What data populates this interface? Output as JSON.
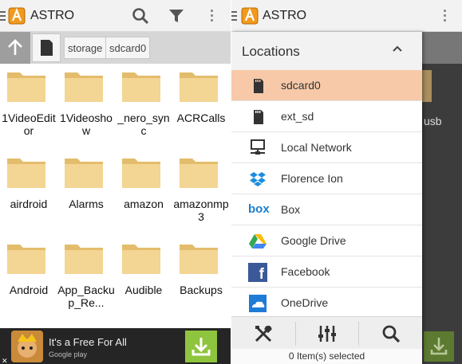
{
  "left_screen": {
    "app_title": "ASTRO",
    "logo_letter": "A",
    "toolbar_icons": [
      "menu-icon",
      "search-icon",
      "filter-icon",
      "overflow-menu-icon"
    ],
    "breadcrumb": [
      "storage",
      "sdcard0"
    ],
    "folders": [
      {
        "name": "1VideoEditor"
      },
      {
        "name": "1Videoshow"
      },
      {
        "name": "_nero_sync"
      },
      {
        "name": "ACRCalls"
      },
      {
        "name": "airdroid"
      },
      {
        "name": "Alarms"
      },
      {
        "name": "amazon"
      },
      {
        "name": "amazonmp3"
      },
      {
        "name": "Android"
      },
      {
        "name": "App_Backup_Re..."
      },
      {
        "name": "Audible"
      },
      {
        "name": "Backups"
      }
    ],
    "ad": {
      "text": "It's a Free For All",
      "store": "Google play",
      "close": "✕"
    }
  },
  "right_screen": {
    "app_title": "ASTRO",
    "logo_letter": "A",
    "drawer": {
      "title": "Locations",
      "items": [
        {
          "label": "sdcard0",
          "icon": "sdcard-icon",
          "selected": true
        },
        {
          "label": "ext_sd",
          "icon": "sdcard-icon",
          "selected": false
        },
        {
          "label": "Local Network",
          "icon": "network-icon",
          "selected": false
        },
        {
          "label": "Florence Ion",
          "icon": "dropbox-icon",
          "selected": false
        },
        {
          "label": "Box",
          "icon": "box-icon",
          "selected": false
        },
        {
          "label": "Google Drive",
          "icon": "google-drive-icon",
          "selected": false
        },
        {
          "label": "Facebook",
          "icon": "facebook-icon",
          "selected": false
        },
        {
          "label": "OneDrive",
          "icon": "onedrive-icon",
          "selected": false
        }
      ],
      "tools": [
        "tools-icon",
        "settings-sliders-icon",
        "search-icon"
      ],
      "status": "0 Item(s) selected",
      "box_logo_text": "box",
      "facebook_logo_text": "f"
    },
    "background_partial_label": "usb"
  },
  "colors": {
    "accent_selected": "#f7c9a8",
    "logo_orange": "#f19a1f",
    "folder_tan": "#f3d594",
    "ad_download_green": "#8fc43e"
  }
}
